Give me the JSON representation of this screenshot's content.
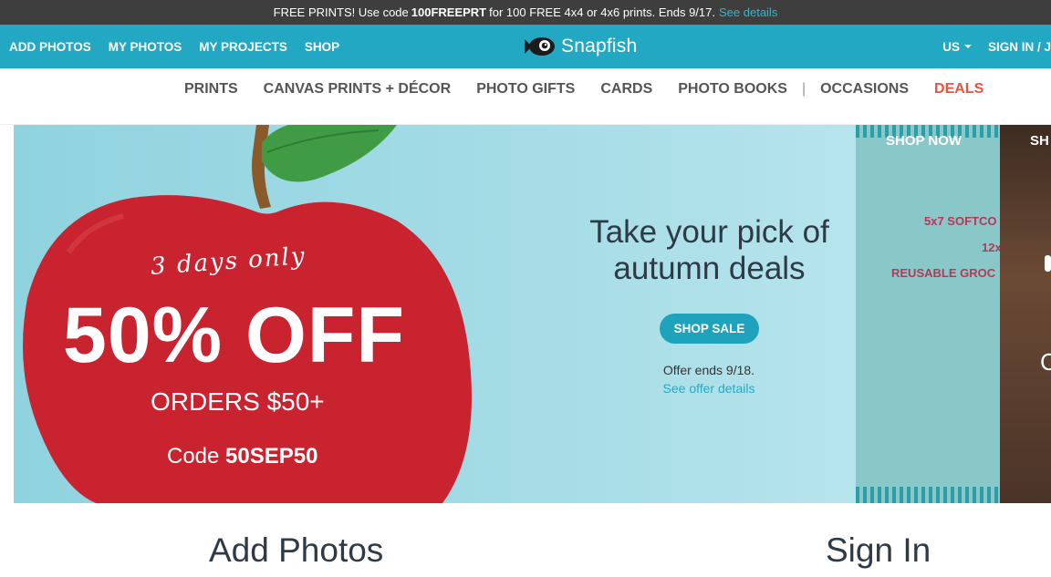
{
  "promo": {
    "text_before": "FREE PRINTS! Use code",
    "code": "100FREEPRT",
    "text_after": "for 100 FREE 4x4 or 4x6 prints. Ends 9/17.",
    "link": "See details"
  },
  "topnav": {
    "items": [
      "ADD PHOTOS",
      "MY PHOTOS",
      "MY PROJECTS",
      "SHOP"
    ],
    "brand": "Snapfish",
    "country": "US",
    "signin": "SIGN IN / J"
  },
  "categories": {
    "items": [
      "PRINTS",
      "CANVAS PRINTS + DÉCOR",
      "PHOTO GIFTS",
      "CARDS",
      "PHOTO BOOKS"
    ],
    "separator": "|",
    "occasions": "OCCASIONS",
    "deals": "DEALS"
  },
  "hero": {
    "script": "3 days only",
    "discount": "50% OFF",
    "orders": "ORDERS $50+",
    "code_label": "Code",
    "code": "50SEP50",
    "headline_line1": "Take your pick of",
    "headline_line2": "autumn deals",
    "button": "SHOP SALE",
    "offer_ends": "Offer ends 9/18.",
    "offer_link": "See offer details"
  },
  "panel2": {
    "shop_now": "SHOP NOW",
    "line1": "5x7 SOFTCO",
    "line2": "12x",
    "line3": "REUSABLE GROC"
  },
  "panel3": {
    "shop": "SH",
    "glyph": "C"
  },
  "sections": {
    "add_photos": "Add Photos",
    "sign_in": "Sign In"
  },
  "colors": {
    "top_bar": "#3e3e3e",
    "nav": "#22a8c2",
    "accent": "#1fa3bd",
    "deals": "#e8543d",
    "apple": "#c9232f",
    "promo_text": "#b23a56"
  }
}
